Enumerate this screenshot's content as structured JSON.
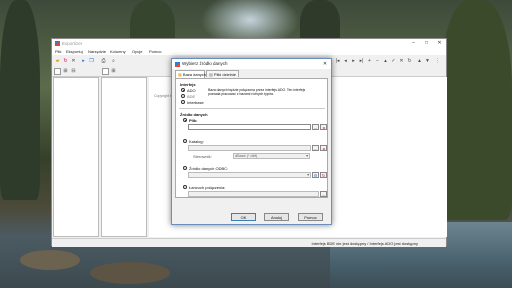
{
  "main": {
    "title": "Exportizer",
    "menu": [
      "Plik",
      "Eksportuj",
      "Narzędzie",
      "Kolumny",
      "Opcje",
      "Pomoc"
    ],
    "brand": "Exportizer",
    "copyright": "Copyright by Vitaliy Levchenko Softw",
    "status": "Interfejs BDE nie jest dostępny / Interfejs ADO jest dostępny"
  },
  "dialog": {
    "title": "Wybierz źródło danych",
    "tabs": [
      "Baza danych",
      "Pliki dzielnie"
    ],
    "interface_label": "Interfejs",
    "interfaces": [
      {
        "label": "ADO",
        "selected": true
      },
      {
        "label": "BDE",
        "selected": false
      },
      {
        "label": "Interbase",
        "selected": false
      }
    ],
    "interface_desc": "Baza danych będzie połączona przez interfejs ADO. Ten interfejs pozwala pracować z bazami różnych typów.",
    "source_label": "Źródło danych",
    "sources": {
      "file_label": "Plik:",
      "file_value": "",
      "catalog_label": "Katalog:",
      "catalog_value": "",
      "driver_label": "Sterownik:",
      "driver_value": "dBase (*.dbf)",
      "odbc_label": "Źródło danych ODBC:",
      "conn_label": "Łańcuch połączenia:"
    },
    "buttons": {
      "ok": "OK",
      "cancel": "Anuluj",
      "help": "Pomoc"
    }
  }
}
